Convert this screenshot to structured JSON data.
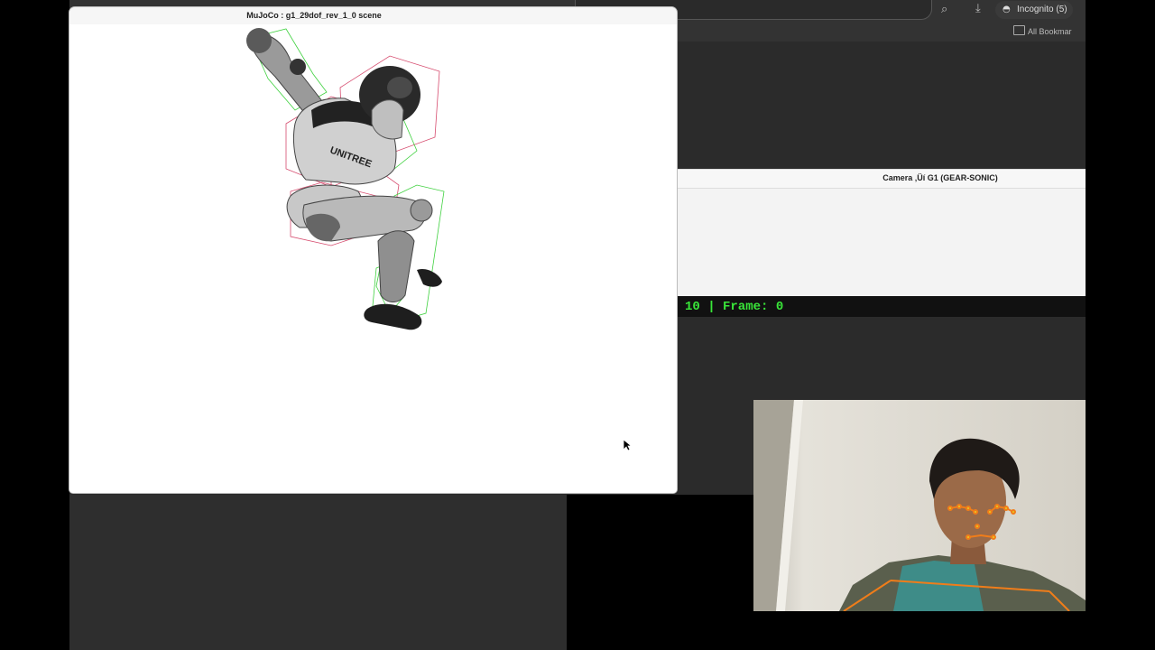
{
  "chrome": {
    "incognito_label": "Incognito (5)",
    "bookmarks_label": "All Bookmar"
  },
  "mujoco": {
    "title": "MuJoCo : g1_29dof_rev_1_0 scene",
    "model_logo_text": "UNITREE"
  },
  "camera": {
    "title": "Camera ‚Üí G1 (GEAR-SONIC)",
    "frame_text": "10 | Frame: 0"
  },
  "colors": {
    "frame_text": "#39e639",
    "collision_box": "#d64b6e",
    "site_box": "#3fd13f",
    "pose_line": "#f07d1a",
    "landmark": "#e8d020"
  },
  "icons": [
    "search-icon",
    "download-icon",
    "incognito-icon",
    "folder-icon",
    "mouse-cursor-icon"
  ]
}
